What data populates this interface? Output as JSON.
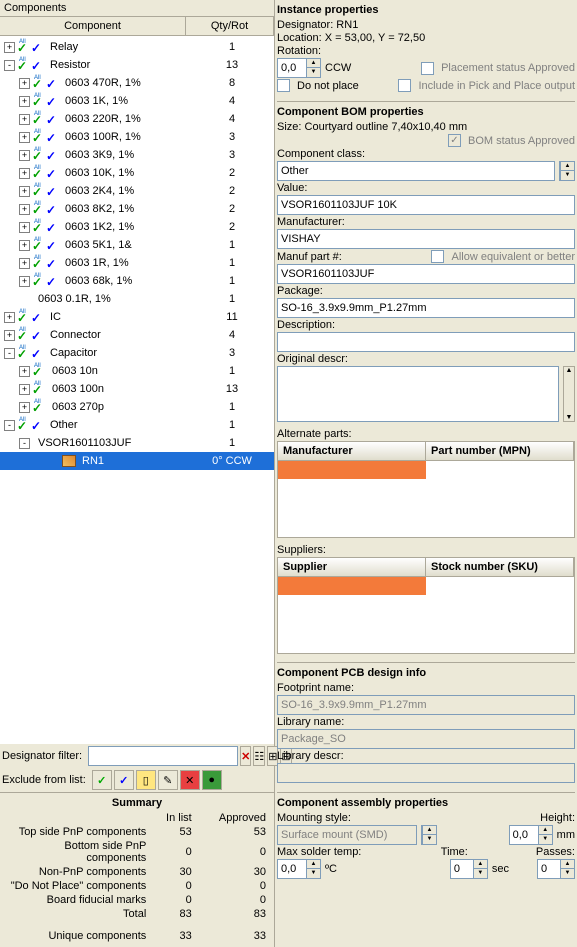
{
  "left": {
    "title": "Components",
    "columns": {
      "component": "Component",
      "qty": "Qty/Rot"
    },
    "tree": [
      {
        "lvl": 0,
        "exp": "+",
        "icons": 2,
        "label": "Relay",
        "qty": "1"
      },
      {
        "lvl": 0,
        "exp": "-",
        "icons": 2,
        "label": "Resistor",
        "qty": "13"
      },
      {
        "lvl": 1,
        "exp": "+",
        "icons": 2,
        "label": "0603 470R, 1%",
        "qty": "8"
      },
      {
        "lvl": 1,
        "exp": "+",
        "icons": 2,
        "label": "0603 1K, 1%",
        "qty": "4"
      },
      {
        "lvl": 1,
        "exp": "+",
        "icons": 2,
        "label": "0603 220R, 1%",
        "qty": "4"
      },
      {
        "lvl": 1,
        "exp": "+",
        "icons": 2,
        "label": "0603 100R, 1%",
        "qty": "3"
      },
      {
        "lvl": 1,
        "exp": "+",
        "icons": 2,
        "label": "0603 3K9, 1%",
        "qty": "3"
      },
      {
        "lvl": 1,
        "exp": "+",
        "icons": 2,
        "label": "0603 10K, 1%",
        "qty": "2"
      },
      {
        "lvl": 1,
        "exp": "+",
        "icons": 2,
        "label": "0603 2K4, 1%",
        "qty": "2"
      },
      {
        "lvl": 1,
        "exp": "+",
        "icons": 2,
        "label": "0603 8K2, 1%",
        "qty": "2"
      },
      {
        "lvl": 1,
        "exp": "+",
        "icons": 2,
        "label": "0603 1K2, 1%",
        "qty": "2"
      },
      {
        "lvl": 1,
        "exp": "+",
        "icons": 2,
        "label": "0603 5K1, 1&",
        "qty": "1"
      },
      {
        "lvl": 1,
        "exp": "+",
        "icons": 2,
        "label": "0603 1R, 1%",
        "qty": "1"
      },
      {
        "lvl": 1,
        "exp": "+",
        "icons": 2,
        "label": "0603 68k, 1%",
        "qty": "1"
      },
      {
        "lvl": 1,
        "exp": "",
        "icons": 0,
        "label": "0603 0.1R, 1%",
        "qty": "1"
      },
      {
        "lvl": 0,
        "exp": "+",
        "icons": 2,
        "label": "IC",
        "qty": "11"
      },
      {
        "lvl": 0,
        "exp": "+",
        "icons": 2,
        "label": "Connector",
        "qty": "4"
      },
      {
        "lvl": 0,
        "exp": "-",
        "icons": 2,
        "label": "Capacitor",
        "qty": "3"
      },
      {
        "lvl": 1,
        "exp": "+",
        "icons": 1,
        "label": "0603 10n",
        "qty": "1"
      },
      {
        "lvl": 1,
        "exp": "+",
        "icons": 1,
        "label": "0603 100n",
        "qty": "13"
      },
      {
        "lvl": 1,
        "exp": "+",
        "icons": 1,
        "label": "0603 270p",
        "qty": "1"
      },
      {
        "lvl": 0,
        "exp": "-",
        "icons": 2,
        "label": "Other",
        "qty": "1"
      },
      {
        "lvl": 1,
        "exp": "-",
        "icons": 0,
        "label": "VSOR1601103JUF",
        "qty": "1"
      },
      {
        "lvl": 3,
        "exp": "",
        "icons": 0,
        "label": "RN1",
        "qty": "0° CCW",
        "selected": true,
        "rnicon": true
      }
    ],
    "filter_label": "Designator filter:",
    "exclude_label": "Exclude from list:",
    "summary": {
      "title": "Summary",
      "headers": {
        "inlist": "In list",
        "approved": "Approved"
      },
      "rows": [
        {
          "label": "Top side PnP components",
          "a": "53",
          "b": "53"
        },
        {
          "label": "Bottom side PnP components",
          "a": "0",
          "b": "0"
        },
        {
          "label": "Non-PnP components",
          "a": "30",
          "b": "30"
        },
        {
          "label": "\"Do Not Place\" components",
          "a": "0",
          "b": "0"
        },
        {
          "label": "Board fiducial marks",
          "a": "0",
          "b": "0"
        },
        {
          "label": "Total",
          "a": "83",
          "b": "83"
        },
        {
          "label": "Unique components",
          "a": "33",
          "b": "33"
        }
      ]
    }
  },
  "instance": {
    "title": "Instance properties",
    "designator": "Designator: RN1",
    "location": "Location:  X = 53,00, Y = 72,50",
    "rotation_label": "Rotation:",
    "rotation_value": "0,0",
    "rotation_dir": "CCW",
    "do_not_place": "Do not place",
    "placement_approved": "Placement status Approved",
    "include_pnp": "Include in Pick and Place output"
  },
  "bom": {
    "title": "Component BOM properties",
    "size": "Size:  Courtyard outline 7,40x10,40 mm",
    "bom_approved": "BOM status Approved",
    "class_label": "Component class:",
    "class_value": "Other",
    "value_label": "Value:",
    "value_value": "VSOR1601103JUF 10K",
    "manuf_label": "Manufacturer:",
    "manuf_value": "VISHAY",
    "mpn_label": "Manuf part #:",
    "mpn_value": "VSOR1601103JUF",
    "allow_equiv": "Allow equivalent or better",
    "package_label": "Package:",
    "package_value": "SO-16_3.9x9.9mm_P1.27mm",
    "desc_label": "Description:",
    "orig_desc_label": "Original descr:",
    "alt_label": "Alternate parts:",
    "alt_headers": {
      "manuf": "Manufacturer",
      "mpn": "Part number (MPN)"
    },
    "sup_label": "Suppliers:",
    "sup_headers": {
      "sup": "Supplier",
      "sku": "Stock number (SKU)"
    }
  },
  "pcb": {
    "title": "Component PCB design info",
    "footprint_label": "Footprint name:",
    "footprint_value": "SO-16_3.9x9.9mm_P1.27mm",
    "libname_label": "Library name:",
    "libname_value": "Package_SO",
    "libdesc_label": "Library descr:"
  },
  "asm": {
    "title": "Component assembly properties",
    "mounting_label": "Mounting style:",
    "mounting_value": "Surface mount (SMD)",
    "height_label": "Height:",
    "height_value": "0,0",
    "mm": "mm",
    "solder_label": "Max solder temp:",
    "solder_value": "0,0",
    "degc": "ºC",
    "time_label": "Time:",
    "time_value": "0",
    "sec": "sec",
    "passes_label": "Passes:",
    "passes_value": "0"
  }
}
